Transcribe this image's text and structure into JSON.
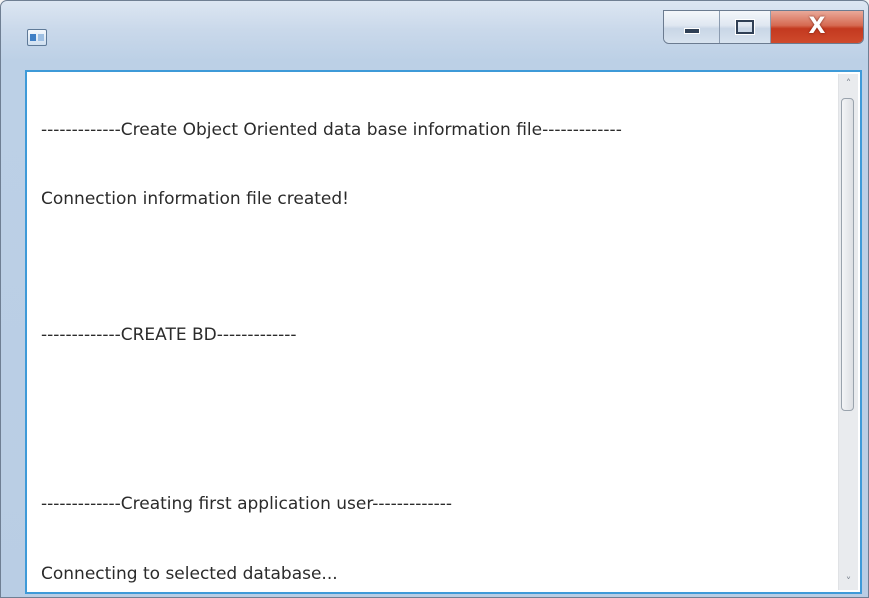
{
  "window": {
    "icon": "app-window-icon",
    "controls": {
      "minimize_icon": "minimize-icon",
      "maximize_icon": "maximize-icon",
      "close_icon": "close-icon",
      "close_glyph": "X"
    }
  },
  "output": {
    "lines": [
      "-------------Create Object Oriented data base information file-------------",
      "Connection information file created!",
      "-------------CREATE BD-------------",
      "-------------Creating first application user-------------",
      "Connecting to selected database..."
    ]
  },
  "scrollbar": {
    "up_arrow": "˄",
    "down_arrow": "˅",
    "up_icon": "chevron-up-icon",
    "down_icon": "chevron-down-icon"
  }
}
